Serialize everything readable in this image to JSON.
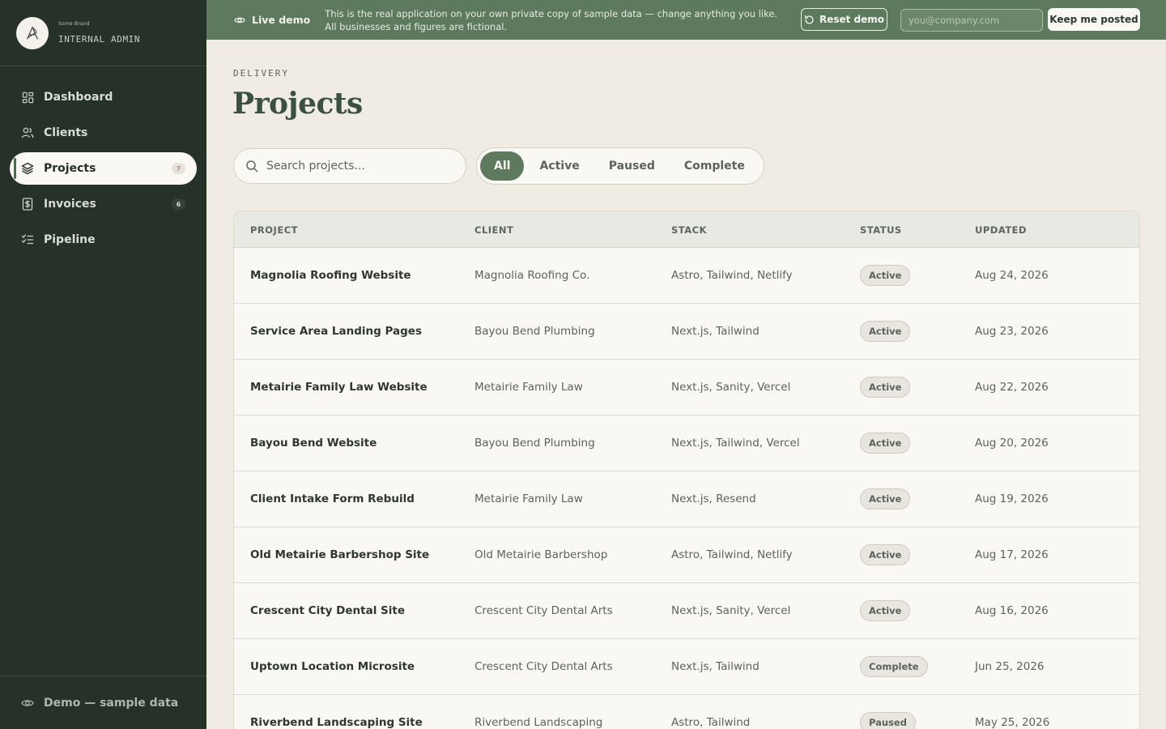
{
  "sidebar": {
    "brand_small": "Some Brand",
    "brand_label": "INTERNAL ADMIN",
    "items": [
      {
        "label": "Dashboard",
        "icon": "grid-icon",
        "badge": ""
      },
      {
        "label": "Clients",
        "icon": "users-icon",
        "badge": ""
      },
      {
        "label": "Projects",
        "icon": "layers-icon",
        "badge": "7",
        "active": true
      },
      {
        "label": "Invoices",
        "icon": "receipt-icon",
        "badge": "6"
      },
      {
        "label": "Pipeline",
        "icon": "list-check-icon",
        "badge": ""
      }
    ],
    "footer": "Demo — sample data"
  },
  "banner": {
    "live_label": "Live demo",
    "message": "This is the real application on your own private copy of sample data — change anything you like. All businesses and figures are fictional.",
    "reset_label": "Reset demo",
    "email_placeholder": "you@company.com",
    "keep_label": "Keep me posted"
  },
  "page": {
    "eyebrow": "DELIVERY",
    "title": "Projects",
    "search_placeholder": "Search projects...",
    "filters": [
      "All",
      "Active",
      "Paused",
      "Complete"
    ],
    "active_filter": "All"
  },
  "table": {
    "columns": [
      "PROJECT",
      "CLIENT",
      "STACK",
      "STATUS",
      "UPDATED"
    ],
    "rows": [
      {
        "project": "Magnolia Roofing Website",
        "client": "Magnolia Roofing Co.",
        "stack": "Astro, Tailwind, Netlify",
        "status": "Active",
        "updated": "Aug 24, 2026"
      },
      {
        "project": "Service Area Landing Pages",
        "client": "Bayou Bend Plumbing",
        "stack": "Next.js, Tailwind",
        "status": "Active",
        "updated": "Aug 23, 2026"
      },
      {
        "project": "Metairie Family Law Website",
        "client": "Metairie Family Law",
        "stack": "Next.js, Sanity, Vercel",
        "status": "Active",
        "updated": "Aug 22, 2026"
      },
      {
        "project": "Bayou Bend Website",
        "client": "Bayou Bend Plumbing",
        "stack": "Next.js, Tailwind, Vercel",
        "status": "Active",
        "updated": "Aug 20, 2026"
      },
      {
        "project": "Client Intake Form Rebuild",
        "client": "Metairie Family Law",
        "stack": "Next.js, Resend",
        "status": "Active",
        "updated": "Aug 19, 2026"
      },
      {
        "project": "Old Metairie Barbershop Site",
        "client": "Old Metairie Barbershop",
        "stack": "Astro, Tailwind, Netlify",
        "status": "Active",
        "updated": "Aug 17, 2026"
      },
      {
        "project": "Crescent City Dental Site",
        "client": "Crescent City Dental Arts",
        "stack": "Next.js, Sanity, Vercel",
        "status": "Active",
        "updated": "Aug 16, 2026"
      },
      {
        "project": "Uptown Location Microsite",
        "client": "Crescent City Dental Arts",
        "stack": "Next.js, Tailwind",
        "status": "Complete",
        "updated": "Jun 25, 2026"
      },
      {
        "project": "Riverbend Landscaping Site",
        "client": "Riverbend Landscaping",
        "stack": "Astro, Tailwind",
        "status": "Paused",
        "updated": "May 25, 2026"
      }
    ]
  },
  "colors": {
    "sidebar_bg": "#263229",
    "banner_bg": "#5d7a5e",
    "accent": "#5d7a5e",
    "page_bg": "#f0ebe3",
    "title": "#3a5140"
  }
}
